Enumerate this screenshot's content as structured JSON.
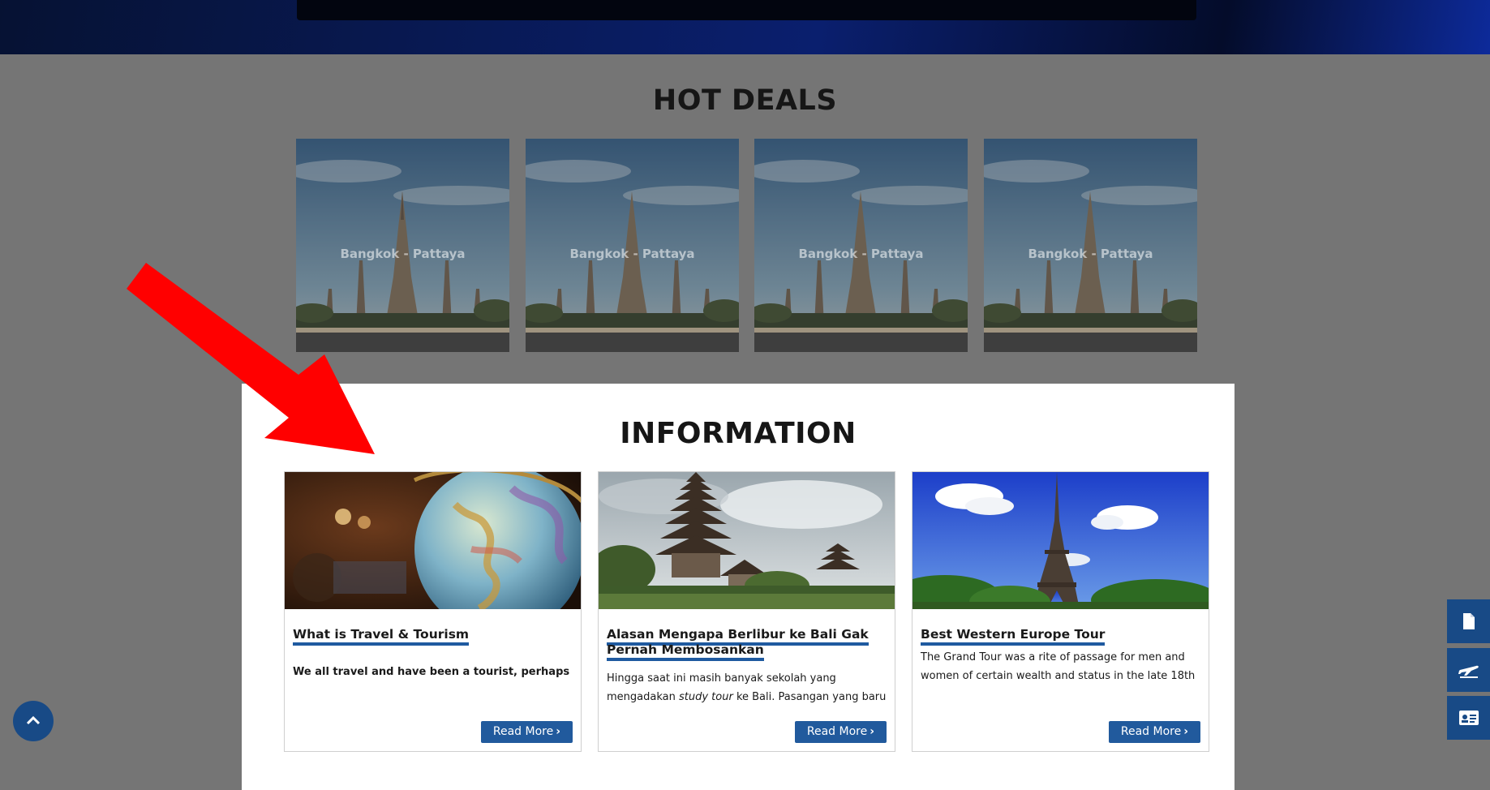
{
  "hot_deals": {
    "title": "HOT DEALS",
    "items": [
      {
        "caption": "Bangkok - Pattaya"
      },
      {
        "caption": "Bangkok - Pattaya"
      },
      {
        "caption": "Bangkok - Pattaya"
      },
      {
        "caption": "Bangkok - Pattaya"
      }
    ]
  },
  "information": {
    "title": "INFORMATION",
    "cards": [
      {
        "title": "What is Travel & Tourism",
        "excerpt": "We all travel and have been a tourist, perhaps",
        "button": "Read More"
      },
      {
        "title": "Alasan Mengapa Berlibur ke Bali Gak Pernah Membosankan",
        "excerpt_before": "Hingga saat ini masih banyak sekolah yang mengadakan ",
        "excerpt_em": "study tour",
        "excerpt_after": " ke Bali. Pasangan yang baru",
        "button": "Read More"
      },
      {
        "title": "Best Western Europe Tour",
        "excerpt": "The Grand Tour was a rite of passage for men and women of certain wealth and status in the late 18th",
        "button": "Read More"
      }
    ]
  },
  "floating": {
    "back_to_top_icon": "chevron-up-icon",
    "side_tabs": [
      "document-icon",
      "flight-icon",
      "id-card-icon"
    ]
  },
  "colors": {
    "accent": "#215a9d",
    "overlay": "#757575",
    "arrow": "#ff0000"
  }
}
